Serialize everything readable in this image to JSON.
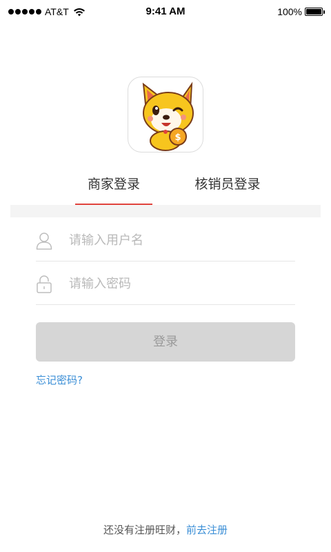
{
  "status_bar": {
    "carrier": "AT&T",
    "time": "9:41 AM",
    "battery_percent": "100%"
  },
  "logo": {
    "icon": "fox-mascot-coin-logo"
  },
  "tabs": [
    {
      "label": "商家登录",
      "active": true
    },
    {
      "label": "核销员登录",
      "active": false
    }
  ],
  "form": {
    "username_placeholder": "请输入用户名",
    "password_placeholder": "请输入密码",
    "username_icon": "user-icon",
    "password_icon": "lock-icon",
    "login_label": "登录",
    "forgot_label": "忘记密码?"
  },
  "footer": {
    "prompt": "还没有注册旺财，",
    "register_link": "前去注册"
  },
  "colors": {
    "accent_red": "#e0423c",
    "link_blue": "#3a8ed6",
    "button_disabled": "#d6d6d6"
  }
}
